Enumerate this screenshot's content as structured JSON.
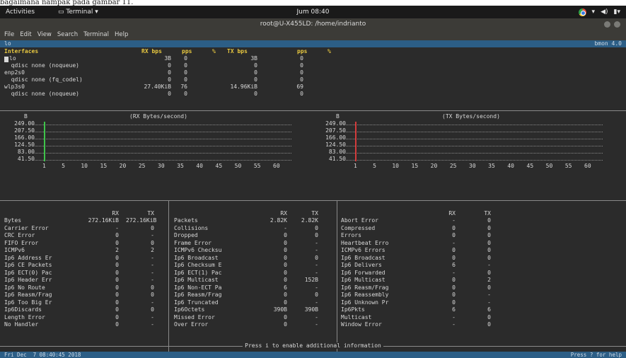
{
  "caption": "bagaimana nampak pada gambar 11.",
  "topbar": {
    "activities": "Activities",
    "app": "▭ Terminal ▾",
    "clock": "Jum 08:40",
    "tray": [
      "▾",
      "◀)",
      "▮▾"
    ]
  },
  "window": {
    "title": "root@U-X455LD: /home/indrianto"
  },
  "menu": [
    "File",
    "Edit",
    "View",
    "Search",
    "Terminal",
    "Help"
  ],
  "bmon": {
    "iface": "lo",
    "version": "bmon 4.0"
  },
  "iface_table": {
    "headers": {
      "name": "Interfaces",
      "rx_bps": "RX bps",
      "rx_pps": "pps",
      "rx_pct": "%",
      "tx_bps": "TX bps",
      "tx_pps": "pps",
      "tx_pct": "%"
    },
    "rows": [
      {
        "name": "lo",
        "rx_bps": "3B",
        "rx_pps": "0",
        "tx_bps": "3B",
        "tx_pps": "0"
      },
      {
        "name": "  qdisc none (noqueue)",
        "rx_bps": "0",
        "rx_pps": "0",
        "tx_bps": "0",
        "tx_pps": "0"
      },
      {
        "name": "enp2s0",
        "rx_bps": "0",
        "rx_pps": "0",
        "tx_bps": "0",
        "tx_pps": "0"
      },
      {
        "name": "  qdisc none (fq_codel)",
        "rx_bps": "0",
        "rx_pps": "0",
        "tx_bps": "0",
        "tx_pps": "0"
      },
      {
        "name": "wlp3s0",
        "rx_bps": "27.40KiB",
        "rx_pps": "76",
        "tx_bps": "14.96KiB",
        "tx_pps": "69"
      },
      {
        "name": "  qdisc none (noqueue)",
        "rx_bps": "0",
        "rx_pps": "0",
        "tx_bps": "0",
        "tx_pps": "0"
      }
    ]
  },
  "graphs": {
    "unit": "B",
    "rx_title": "(RX Bytes/second)",
    "tx_title": "(TX Bytes/second)",
    "y_ticks": [
      "249.00",
      "207.50",
      "166.00",
      "124.50",
      "83.00",
      "41.50"
    ],
    "x_ticks": [
      "1",
      "5",
      "10",
      "15",
      "20",
      "25",
      "30",
      "35",
      "40",
      "45",
      "50",
      "55",
      "60"
    ],
    "rx_spike": {
      "value": 249,
      "color": "#3fc34a"
    },
    "tx_spike": {
      "value": 249,
      "color": "#d23b3b"
    }
  },
  "stats": {
    "col_headers": {
      "rx": "RX",
      "tx": "TX"
    },
    "col1": [
      [
        "Bytes",
        "272.16KiB",
        "272.16KiB"
      ],
      [
        "Carrier Error",
        "-",
        "0"
      ],
      [
        "CRC Error",
        "0",
        "-"
      ],
      [
        "FIFO Error",
        "0",
        "0"
      ],
      [
        "ICMPv6",
        "2",
        "2"
      ],
      [
        "Ip6 Address Er",
        "0",
        "-"
      ],
      [
        "Ip6 CE Packets",
        "0",
        "-"
      ],
      [
        "Ip6 ECT(0) Pac",
        "0",
        "-"
      ],
      [
        "Ip6 Header Err",
        "0",
        "-"
      ],
      [
        "Ip6 No Route",
        "0",
        "0"
      ],
      [
        "Ip6 Reasm/Frag",
        "0",
        "0"
      ],
      [
        "Ip6 Too Big Er",
        "0",
        "-"
      ],
      [
        "Ip6Discards",
        "0",
        "0"
      ],
      [
        "Length Error",
        "0",
        "-"
      ],
      [
        "No Handler",
        "0",
        "-"
      ]
    ],
    "col2": [
      [
        "Packets",
        "2.82K",
        "2.82K"
      ],
      [
        "Collisions",
        "-",
        "0"
      ],
      [
        "Dropped",
        "0",
        "0"
      ],
      [
        "Frame Error",
        "0",
        "-"
      ],
      [
        "ICMPv6 Checksu",
        "0",
        "-"
      ],
      [
        "Ip6 Broadcast",
        "0",
        "0"
      ],
      [
        "Ip6 Checksum E",
        "0",
        "-"
      ],
      [
        "Ip6 ECT(1) Pac",
        "0",
        "-"
      ],
      [
        "Ip6 Multicast",
        "0",
        "152B"
      ],
      [
        "Ip6 Non-ECT Pa",
        "6",
        "-"
      ],
      [
        "Ip6 Reasm/Frag",
        "0",
        "0"
      ],
      [
        "Ip6 Truncated",
        "0",
        "-"
      ],
      [
        "Ip6Octets",
        "390B",
        "390B"
      ],
      [
        "Missed Error",
        "0",
        "-"
      ],
      [
        "Over Error",
        "0",
        "-"
      ]
    ],
    "col3": [
      [
        "Abort Error",
        "-",
        "0"
      ],
      [
        "Compressed",
        "0",
        "0"
      ],
      [
        "Errors",
        "0",
        "0"
      ],
      [
        "Heartbeat Erro",
        "-",
        "0"
      ],
      [
        "ICMPv6 Errors",
        "0",
        "0"
      ],
      [
        "Ip6 Broadcast",
        "0",
        "0"
      ],
      [
        "Ip6 Delivers",
        "6",
        "-"
      ],
      [
        "Ip6 Forwarded",
        "-",
        "0"
      ],
      [
        "Ip6 Multicast",
        "0",
        "2"
      ],
      [
        "Ip6 Reasm/Frag",
        "0",
        "0"
      ],
      [
        "Ip6 Reassembly",
        "0",
        "-"
      ],
      [
        "Ip6 Unknown Pr",
        "0",
        "-"
      ],
      [
        "Ip6Pkts",
        "6",
        "6"
      ],
      [
        "Multicast",
        "-",
        "0"
      ],
      [
        "Window Error",
        "-",
        "0"
      ]
    ]
  },
  "help_hint": "Press i to enable additional information",
  "status": {
    "datetime": "Fri Dec  7 08:40:45 2018",
    "help": "Press ? for help"
  }
}
